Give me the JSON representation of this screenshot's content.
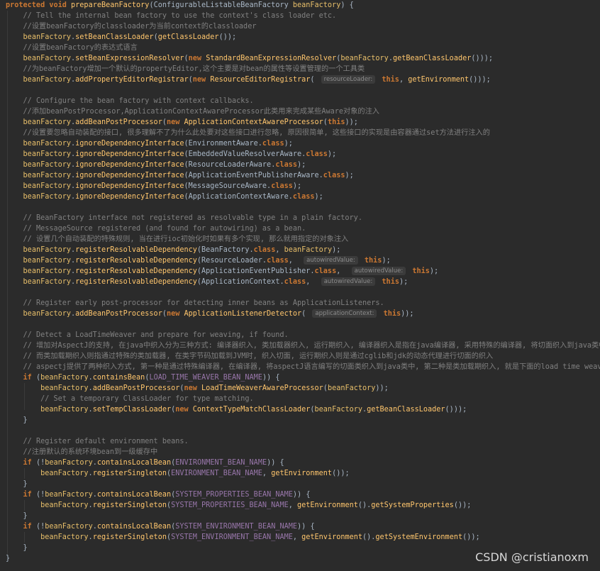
{
  "code_lines": [
    "protected void prepareBeanFactory(ConfigurableListableBeanFactory beanFactory) {",
    "    // Tell the internal bean factory to use the context's class loader etc.",
    "    //设置beanFactory的classloader为当前context的classloader",
    "    beanFactory.setBeanClassLoader(getClassLoader());",
    "    //设置beanFactory的表达式语言",
    "    beanFactory.setBeanExpressionResolver(new StandardBeanExpressionResolver(beanFactory.getBeanClassLoader()));",
    "    //为beanFactory增加一个默认的propertyEditor,这个主要是对bean的属性等设置管理的一个工具类",
    "    beanFactory.addPropertyEditorRegistrar(new ResourceEditorRegistrar( resourceLoader: this, getEnvironment()));",
    "",
    "    // Configure the bean factory with context callbacks.",
    "    //添加beanPostProcessor,ApplicationContextAwareProcessor此类用来完成某些Aware对象的注入",
    "    beanFactory.addBeanPostProcessor(new ApplicationContextAwareProcessor(this));",
    "    //设置要忽略自动装配的接口, 很多理解不了为什么此处要对这些接口进行忽略, 原因很简单, 这些接口的实现是由容器通过set方法进行注入的",
    "    beanFactory.ignoreDependencyInterface(EnvironmentAware.class);",
    "    beanFactory.ignoreDependencyInterface(EmbeddedValueResolverAware.class);",
    "    beanFactory.ignoreDependencyInterface(ResourceLoaderAware.class);",
    "    beanFactory.ignoreDependencyInterface(ApplicationEventPublisherAware.class);",
    "    beanFactory.ignoreDependencyInterface(MessageSourceAware.class);",
    "    beanFactory.ignoreDependencyInterface(ApplicationContextAware.class);",
    "",
    "    // BeanFactory interface not registered as resolvable type in a plain factory.",
    "    // MessageSource registered (and found for autowiring) as a bean.",
    "    // 设置几个自动装配的特殊规则, 当在进行ioc初始化时如果有多个实现, 那么就用指定的对象注入",
    "    beanFactory.registerResolvableDependency(BeanFactory.class, beanFactory);",
    "    beanFactory.registerResolvableDependency(ResourceLoader.class,  autowiredValue: this);",
    "    beanFactory.registerResolvableDependency(ApplicationEventPublisher.class,  autowiredValue: this);",
    "    beanFactory.registerResolvableDependency(ApplicationContext.class,  autowiredValue: this);",
    "",
    "    // Register early post-processor for detecting inner beans as ApplicationListeners.",
    "    beanFactory.addBeanPostProcessor(new ApplicationListenerDetector( applicationContext: this));",
    "",
    "    // Detect a LoadTimeWeaver and prepare for weaving, if found.",
    "    // 增加对AspectJ的支持, 在java中织入分为三种方式: 编译器织入, 类加载器织入, 运行期织入, 编译器织入是指在java编译器, 采用特殊的编译器, 将切面织入到java类中",
    "    // 而类加载期织入则指通过特殊的类加载器, 在类字节码加载到JVM时, 织入切面, 运行期织入则是通过cglib和jdk的动态代理进行切面的织入",
    "    // aspectj提供了两种织入方式, 第一种是通过特殊编译器, 在编译器, 将aspectJ语言编写的切面类织入到java类中, 第二种是类加载期织入, 就是下面的load time weaving",
    "    if (beanFactory.containsBean(LOAD_TIME_WEAVER_BEAN_NAME)) {",
    "        beanFactory.addBeanPostProcessor(new LoadTimeWeaverAwareProcessor(beanFactory));",
    "        // Set a temporary ClassLoader for type matching.",
    "        beanFactory.setTempClassLoader(new ContextTypeMatchClassLoader(beanFactory.getBeanClassLoader()));",
    "    }",
    "",
    "    // Register default environment beans.",
    "    //注册默认的系统环境bean到一级缓存中",
    "    if (!beanFactory.containsLocalBean(ENVIRONMENT_BEAN_NAME)) {",
    "        beanFactory.registerSingleton(ENVIRONMENT_BEAN_NAME, getEnvironment());",
    "    }",
    "    if (!beanFactory.containsLocalBean(SYSTEM_PROPERTIES_BEAN_NAME)) {",
    "        beanFactory.registerSingleton(SYSTEM_PROPERTIES_BEAN_NAME, getEnvironment().getSystemProperties());",
    "    }",
    "    if (!beanFactory.containsLocalBean(SYSTEM_ENVIRONMENT_BEAN_NAME)) {",
    "        beanFactory.registerSingleton(SYSTEM_ENVIRONMENT_BEAN_NAME, getEnvironment().getSystemEnvironment());",
    "    }",
    "}"
  ],
  "watermark": "CSDN @cristianoxm"
}
